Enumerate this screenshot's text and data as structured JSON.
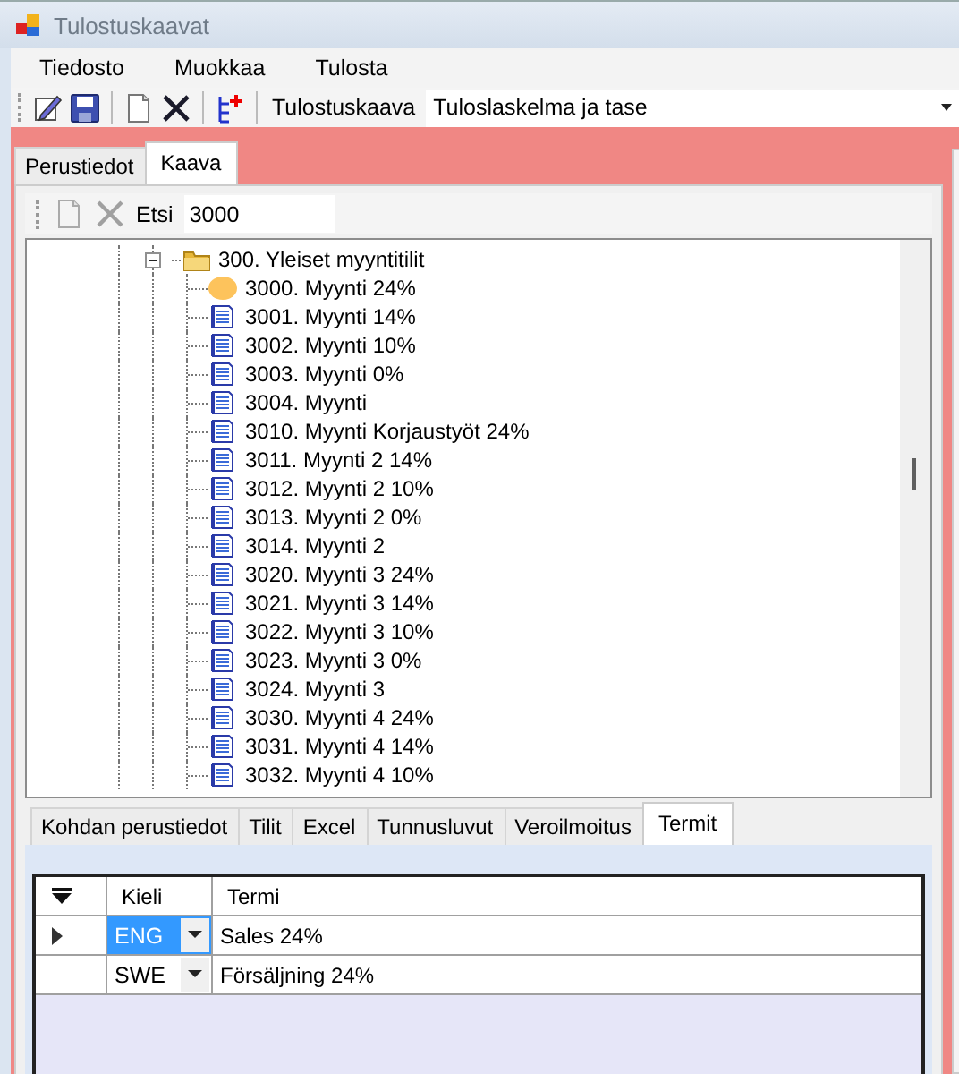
{
  "window": {
    "title": "Tulostuskaavat"
  },
  "menu": [
    "Tiedosto",
    "Muokkaa",
    "Tulosta"
  ],
  "toolbar": {
    "label": "Tulostuskaava",
    "combo_value": "Tuloslaskelma ja tase"
  },
  "tabs": [
    {
      "label": "Perustiedot",
      "selected": false
    },
    {
      "label": "Kaava",
      "selected": true
    }
  ],
  "tree_toolbar": {
    "buttons": [
      {
        "disabled": true
      },
      {
        "disabled": true
      }
    ],
    "search_label": "Etsi",
    "search_value": "3000"
  },
  "tree": {
    "items": [
      {
        "label": "300. Yleiset myyntitilit",
        "expanded": true,
        "children": [
          {
            "label": "3000. Myynti 24%",
            "selected": true
          },
          {
            "label": "3001. Myynti 14%",
            "selected": false
          },
          {
            "label": "3002. Myynti 10%",
            "selected": false
          },
          {
            "label": "3003. Myynti 0%",
            "selected": false
          },
          {
            "label": "3004. Myynti",
            "selected": false
          },
          {
            "label": "3010. Myynti Korjaustyöt 24%",
            "selected": false
          },
          {
            "label": "3011. Myynti 2 14%",
            "selected": false
          },
          {
            "label": "3012. Myynti 2 10%",
            "selected": false
          },
          {
            "label": "3013. Myynti 2 0%",
            "selected": false
          },
          {
            "label": "3014. Myynti 2",
            "selected": false
          },
          {
            "label": "3020. Myynti 3 24%",
            "selected": false
          },
          {
            "label": "3021. Myynti 3 14%",
            "selected": false
          },
          {
            "label": "3022. Myynti 3 10%",
            "selected": false
          },
          {
            "label": "3023. Myynti 3 0%",
            "selected": false
          },
          {
            "label": "3024. Myynti 3",
            "selected": false
          },
          {
            "label": "3030. Myynti 4 24%",
            "selected": false
          },
          {
            "label": "3031. Myynti 4 14%",
            "selected": false
          },
          {
            "label": "3032. Myynti 4 10%",
            "selected": false
          }
        ]
      }
    ]
  },
  "detail_tabs": [
    {
      "label": "Kohdan perustiedot",
      "selected": false
    },
    {
      "label": "Tilit",
      "selected": false
    },
    {
      "label": "Excel",
      "selected": false
    },
    {
      "label": "Tunnusluvut",
      "selected": false
    },
    {
      "label": "Veroilmoitus",
      "selected": false
    },
    {
      "label": "Termit",
      "selected": true
    }
  ],
  "grid": {
    "columns": [
      "Kieli",
      "Termi"
    ],
    "rows": [
      {
        "language": "ENG",
        "term": "Sales 24%",
        "selected": true
      },
      {
        "language": "SWE",
        "term": "Försäljning 24%",
        "selected": false
      }
    ]
  }
}
